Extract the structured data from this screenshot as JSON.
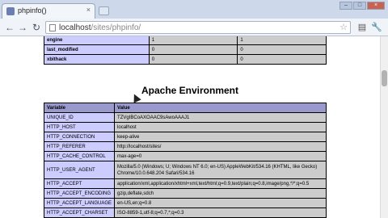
{
  "browser": {
    "tab_title": "phpinfo()",
    "tab_close": "×",
    "url_host": "localhost",
    "url_path": "/sites/phpinfo/",
    "back": "←",
    "forward": "→",
    "reload": "↻",
    "star": "☆",
    "wrench": "🔧",
    "minimize": "–",
    "maximize": "□",
    "close": "×"
  },
  "section_title": "Apache Environment",
  "top_table": {
    "rows": [
      [
        "engine",
        "1",
        "1"
      ],
      [
        "last_modified",
        "0",
        "0"
      ],
      [
        "xbithack",
        "0",
        "0"
      ]
    ]
  },
  "env_table": {
    "headers": [
      "Variable",
      "Value"
    ],
    "rows": [
      [
        "UNIQUE_ID",
        "TZVgIBCoAXOAAC9sAwoAAAJ1"
      ],
      [
        "HTTP_HOST",
        "localhost"
      ],
      [
        "HTTP_CONNECTION",
        "keep-alive"
      ],
      [
        "HTTP_REFERER",
        "http://localhost/sites/"
      ],
      [
        "HTTP_CACHE_CONTROL",
        "max-age=0"
      ],
      [
        "HTTP_USER_AGENT",
        "Mozilla/5.0 (Windows; U; Windows NT 6.0; en-US) AppleWebKit/534.16 (KHTML, like Gecko) Chrome/10.0.648.204 Safari/534.16"
      ],
      [
        "HTTP_ACCEPT",
        "application/xml,application/xhtml+xml,text/html;q=0.9,text/plain;q=0.8,image/png,*/*;q=0.5"
      ],
      [
        "HTTP_ACCEPT_ENCODING",
        "gzip,deflate,sdch"
      ],
      [
        "HTTP_ACCEPT_LANGUAGE",
        "en-US,en;q=0.8"
      ],
      [
        "HTTP_ACCEPT_CHARSET",
        "ISO-8859-1,utf-8;q=0.7,*;q=0.3"
      ]
    ]
  },
  "colors": {
    "label_cell": "#ccccff",
    "value_cell": "#cccccc",
    "header_cell": "#9999cc"
  }
}
